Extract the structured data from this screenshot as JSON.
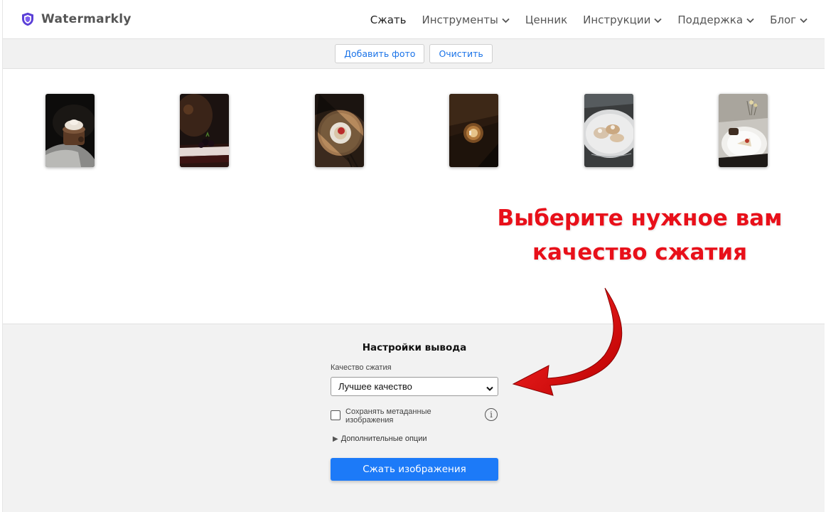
{
  "header": {
    "logo_text": "Watermarkly",
    "nav": [
      {
        "label": "Сжать",
        "has_dropdown": false,
        "active": true
      },
      {
        "label": "Инструменты",
        "has_dropdown": true
      },
      {
        "label": "Ценник",
        "has_dropdown": false
      },
      {
        "label": "Инструкции",
        "has_dropdown": true
      },
      {
        "label": "Поддержка",
        "has_dropdown": true
      },
      {
        "label": "Блог",
        "has_dropdown": true
      }
    ]
  },
  "toolbar": {
    "add_photo_label": "Добавить фото",
    "clear_label": "Очистить"
  },
  "gallery": {
    "images": [
      {
        "name": "photo-1",
        "subject": "cupcake with cream"
      },
      {
        "name": "photo-2",
        "subject": "cake slice with berries"
      },
      {
        "name": "photo-3",
        "subject": "dessert on round tray"
      },
      {
        "name": "photo-4",
        "subject": "dessert on dark table"
      },
      {
        "name": "photo-5",
        "subject": "pastries on plate"
      },
      {
        "name": "photo-6",
        "subject": "dessert on white plate"
      }
    ]
  },
  "callout": {
    "line1": "Выберите нужное вам",
    "line2": "качество сжатия"
  },
  "settings": {
    "title": "Настройки вывода",
    "quality_label": "Качество сжатия",
    "quality_value": "Лучшее качество",
    "keep_metadata_label": "Сохранять метаданные изображения",
    "keep_metadata_checked": false,
    "advanced_label": "Дополнительные опции",
    "compress_button": "Сжать изображения"
  },
  "colors": {
    "accent": "#1c7af8",
    "link": "#1a73e8",
    "callout": "#e8101a",
    "logo_shield": "#5a3fd6"
  }
}
